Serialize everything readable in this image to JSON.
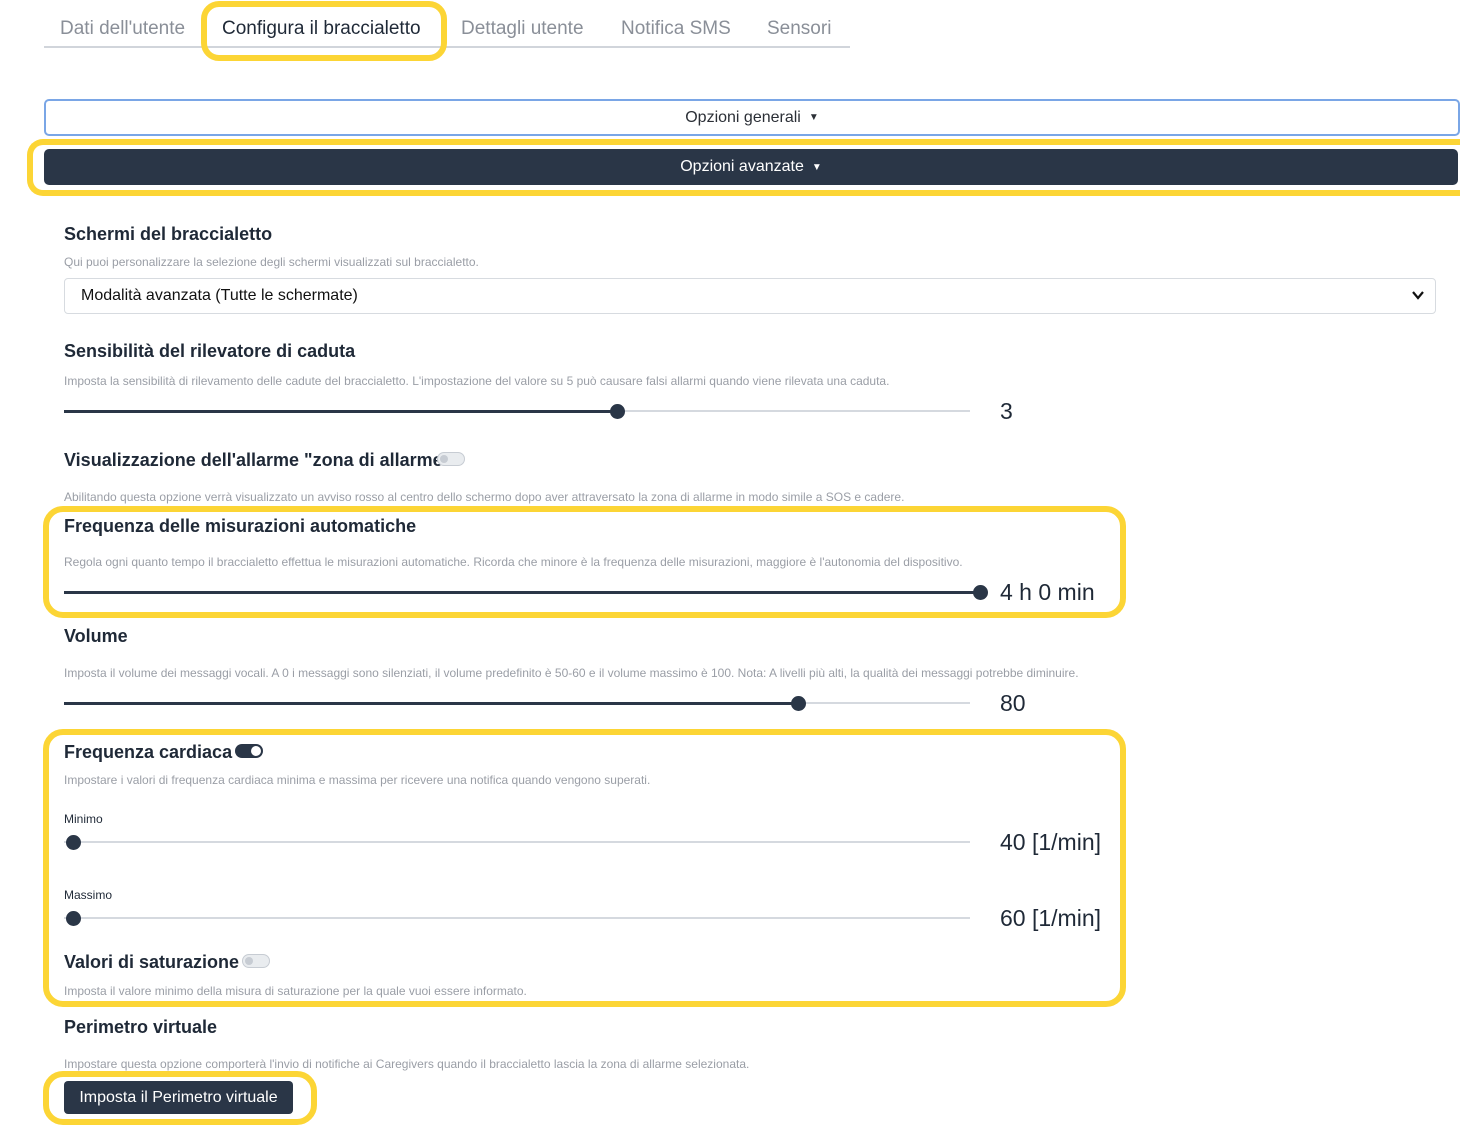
{
  "tabs": [
    {
      "label": "Dati dell'utente",
      "active": false
    },
    {
      "label": "Configura il braccialetto",
      "active": true
    },
    {
      "label": "Dettagli utente",
      "active": false
    },
    {
      "label": "Notifica SMS",
      "active": false
    },
    {
      "label": "Sensori",
      "active": false
    }
  ],
  "accordions": {
    "general": "Opzioni generali",
    "advanced": "Opzioni avanzate"
  },
  "screens": {
    "title": "Schermi del braccialetto",
    "description": "Qui puoi personalizzare la selezione degli schermi visualizzati sul braccialetto.",
    "selected": "Modalità avanzata (Tutte le schermate)"
  },
  "fall_sensitivity": {
    "title": "Sensibilità del rilevatore di caduta",
    "description": "Imposta la sensibilità di rilevamento delle cadute del braccialetto. L'impostazione del valore su 5 può causare falsi allarmi quando viene rilevata una caduta.",
    "value": "3"
  },
  "alarm_zone": {
    "title": "Visualizzazione dell'allarme \"zona di allarme\"",
    "enabled": false,
    "description": "Abilitando questa opzione verrà visualizzato un avviso rosso al centro dello schermo dopo aver attraversato la zona di allarme in modo simile a SOS e cadere."
  },
  "auto_measure": {
    "title": "Frequenza delle misurazioni automatiche",
    "description": "Regola ogni quanto tempo il braccialetto effettua le misurazioni automatiche. Ricorda che minore è la frequenza delle misurazioni, maggiore è l'autonomia del dispositivo.",
    "value": "4 h 0 min"
  },
  "volume": {
    "title": "Volume",
    "description": "Imposta il volume dei messaggi vocali. A 0 i messaggi sono silenziati, il volume predefinito è 50-60 e il volume massimo è 100. Nota: A livelli più alti, la qualità dei messaggi potrebbe diminuire.",
    "value": "80"
  },
  "heart_rate": {
    "title": "Frequenza cardiaca",
    "enabled": true,
    "description": "Impostare i valori di frequenza cardiaca minima e massima per ricevere una notifica quando vengono superati.",
    "min_label": "Minimo",
    "min_value": "40 [1/min]",
    "max_label": "Massimo",
    "max_value": "60 [1/min]"
  },
  "saturation": {
    "title": "Valori di saturazione",
    "enabled": false,
    "description": "Imposta il valore minimo della misura di saturazione per la quale vuoi essere informato."
  },
  "geofence": {
    "title": "Perimetro virtuale",
    "description": "Impostare questa opzione comporterà l'invio di notifiche ai Caregivers quando il braccialetto lascia la zona di allarme selezionata.",
    "button": "Imposta il Perimetro virtuale"
  },
  "colors": {
    "dark": "#2a3647",
    "highlight": "#fcd535",
    "accordion_border": "#7aa6e6"
  }
}
